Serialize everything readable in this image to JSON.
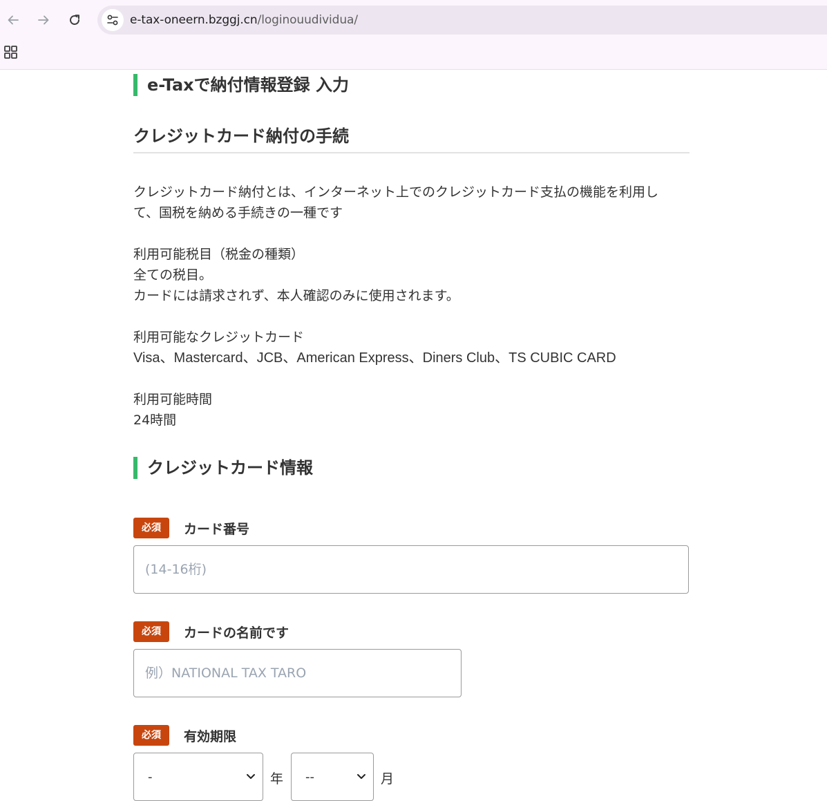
{
  "browser": {
    "url_host": "e-tax-oneern.bzggj.cn",
    "url_path": "/loginouudividua/",
    "icons": [
      "back-arrow-icon",
      "forward-arrow-icon",
      "reload-icon",
      "site-settings-icon",
      "apps-grid-icon"
    ]
  },
  "page": {
    "section1_title": "e-Taxで納付情報登録 入力",
    "procedure_title": "クレジットカード納付の手続",
    "intro_line1": "クレジットカード納付とは、インターネット上でのクレジットカード支払の機能を利用し",
    "intro_line2": "て、国税を納める手続きの一種です",
    "tax_items_heading": "利用可能税目（税金の種類）",
    "tax_items_value": "全ての税目。",
    "tax_items_note": "カードには請求されず、本人確認のみに使用されます。",
    "cards_heading": "利用可能なクレジットカード",
    "cards_value": "Visa、Mastercard、JCB、American Express、Diners Club、TS CUBIC CARD",
    "hours_heading": "利用可能時間",
    "hours_value": "24時間",
    "section2_title": "クレジットカード情報"
  },
  "form": {
    "required_badge": "必須",
    "card_number_label": "カード番号",
    "card_number_placeholder": "(14-16桁)",
    "card_name_label": "カードの名前です",
    "card_name_placeholder": "例）NATIONAL TAX TARO",
    "expiry_label": "有効期限",
    "expiry_year_value": "-",
    "expiry_year_unit": "年",
    "expiry_month_value": "--",
    "expiry_month_unit": "月"
  },
  "colors": {
    "accent_green": "#36b96a",
    "required_badge": "#c8460e",
    "chrome_bg": "#fcf5fd",
    "omnibox_bg": "#ede6f1"
  }
}
